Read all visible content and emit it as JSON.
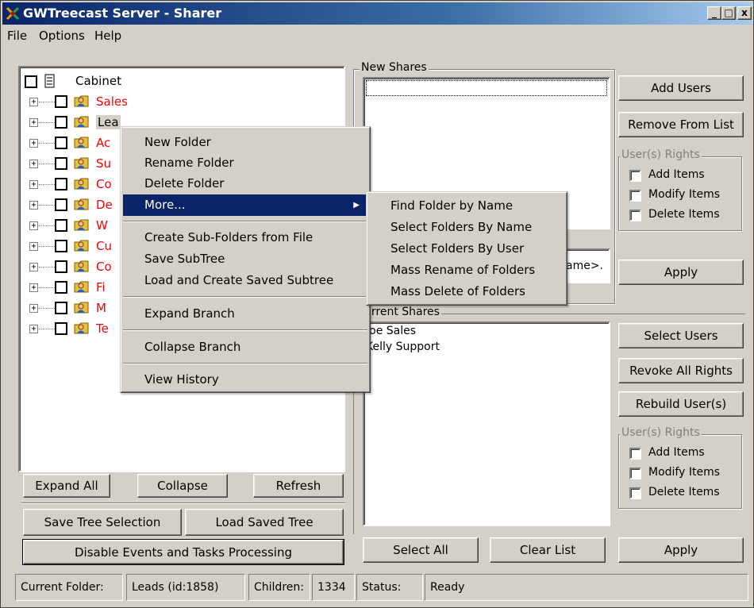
{
  "window": {
    "title": "GWTreecast Server - Sharer",
    "minimize": "_",
    "maximize": "□",
    "close": "x"
  },
  "menu": [
    "File",
    "Options",
    "Help"
  ],
  "tree": {
    "root": "Cabinet",
    "items": [
      {
        "label": "Sales",
        "red": true
      },
      {
        "label": "Lea",
        "red": false,
        "selected": true
      },
      {
        "label": "Ac",
        "red": true
      },
      {
        "label": "Su",
        "red": true
      },
      {
        "label": "Co",
        "red": true
      },
      {
        "label": "De",
        "red": true
      },
      {
        "label": "W",
        "red": true
      },
      {
        "label": "Cu",
        "red": true
      },
      {
        "label": "Co",
        "red": true
      },
      {
        "label": "Fi",
        "red": true
      },
      {
        "label": "M",
        "red": true
      },
      {
        "label": "Te",
        "red": true
      }
    ]
  },
  "tree_buttons": {
    "expand_all": "Expand All",
    "collapse": "Collapse",
    "refresh": "Refresh",
    "save_tree": "Save Tree Selection",
    "load_tree": "Load Saved Tree",
    "disable_events": "Disable Events and Tasks Processing"
  },
  "context_menu": {
    "items": [
      "New Folder",
      "Rename Folder",
      "Delete Folder",
      "More...",
      "Create Sub-Folders from File",
      "Save SubTree",
      "Load and Create Saved Subtree",
      "Expand Branch",
      "Collapse Branch",
      "View History"
    ]
  },
  "submenu": {
    "items": [
      "Find Folder by Name",
      "Select Folders By Name",
      "Select Folders By User",
      "Mass Rename of Folders",
      "Mass Delete of Folders"
    ]
  },
  "new_shares": {
    "label": "New Shares",
    "add_users": "Add Users",
    "remove_from_list": "Remove From List",
    "rights_label": "User(s) Rights",
    "rights": [
      "Add Items",
      "Modify Items",
      "Delete Items"
    ],
    "folder_field_visible": "ame>.",
    "apply": "Apply"
  },
  "current_shares": {
    "label": "urrent Shares",
    "users": [
      "Joe Sales",
      "Kelly Support"
    ],
    "select_users": "Select Users",
    "revoke_all": "Revoke All Rights",
    "rebuild": "Rebuild User(s)",
    "rights_label": "User(s) Rights",
    "rights": [
      "Add Items",
      "Modify Items",
      "Delete Items"
    ],
    "select_all": "Select All",
    "clear_list": "Clear List",
    "apply": "Apply"
  },
  "status": {
    "current_folder_label": "Current Folder:",
    "current_folder": "Leads (id:1858)",
    "children_label": "Children:",
    "children": "1334",
    "status_label": "Status:",
    "status": "Ready"
  }
}
